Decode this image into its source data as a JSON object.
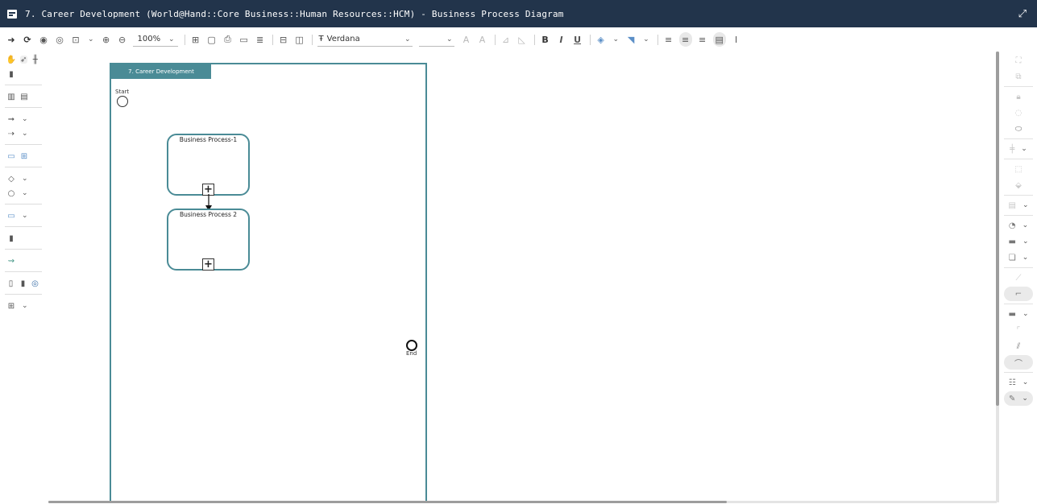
{
  "window": {
    "title": "7. Career Development (World@Hand::Core Business::Human Resources::HCM) - Business Process Diagram"
  },
  "toolbar": {
    "zoom": "100%",
    "font": "Verdana",
    "bold_label": "B",
    "italic_label": "I",
    "underline_label": "U",
    "text_label": "I"
  },
  "diagram": {
    "pool_label": "7. Career Development",
    "start_label": "Start",
    "end_label": "End",
    "tasks": [
      {
        "label": "Business Process-1",
        "marker": "+"
      },
      {
        "label": "Business Process 2",
        "marker": "+"
      }
    ]
  },
  "colors": {
    "titlebar": "#22344b",
    "accent": "#4a8b96"
  }
}
